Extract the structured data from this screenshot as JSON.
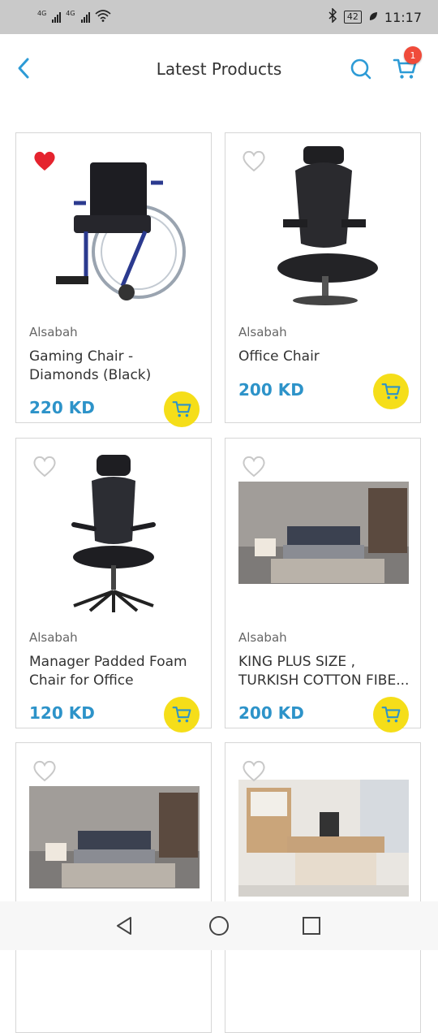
{
  "status_bar": {
    "network_1": "4G",
    "network_2": "4G",
    "bluetooth_icon": "bluetooth-icon",
    "battery": "42",
    "time": "11:17"
  },
  "header": {
    "title": "Latest Products",
    "back_icon": "chevron-left-icon",
    "search_icon": "search-icon",
    "cart_icon": "cart-icon",
    "cart_count": "1",
    "accent_color": "#2d9bd6"
  },
  "products": [
    {
      "brand": "Alsabah",
      "name": "Gaming Chair - Diamonds (Black)",
      "price": "220 KD",
      "favorited": true,
      "image": "wheelchair"
    },
    {
      "brand": "Alsabah",
      "name": "Office Chair",
      "price": "200 KD",
      "favorited": false,
      "image": "mesh-office-chair"
    },
    {
      "brand": "Alsabah",
      "name": "Manager Padded Foam Chair for Office",
      "price": "120 KD",
      "favorited": false,
      "image": "manager-chair"
    },
    {
      "brand": "Alsabah",
      "name": "KING PLUS SIZE , TURKISH COTTON FIBE...",
      "price": "200 KD",
      "favorited": false,
      "image": "bedroom-set"
    },
    {
      "brand": "",
      "name": "",
      "price": "",
      "favorited": false,
      "image": "bedroom-set"
    },
    {
      "brand": "",
      "name": "",
      "price": "",
      "favorited": false,
      "image": "office-desk-set"
    }
  ],
  "colors": {
    "price": "#2d93c9",
    "add_to_cart_button": "#f5de19",
    "favorite_active": "#e5232e",
    "favorite_inactive": "#c8c8c8",
    "badge": "#f04b3a"
  },
  "nav_bar": {
    "back": "triangle-back-icon",
    "home": "circle-home-icon",
    "recents": "square-recents-icon"
  }
}
